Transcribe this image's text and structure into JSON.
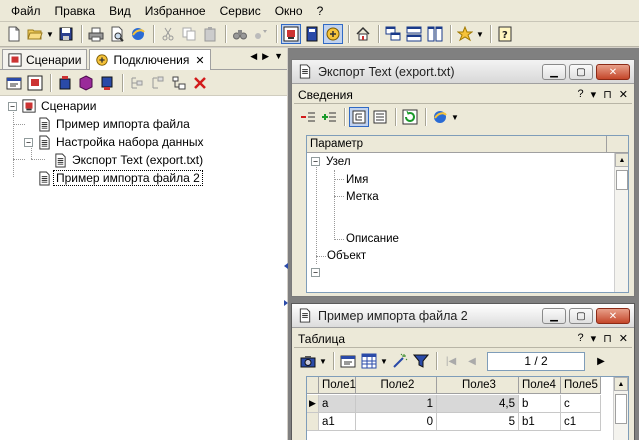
{
  "menu": [
    "Файл",
    "Правка",
    "Вид",
    "Избранное",
    "Сервис",
    "Окно",
    "?"
  ],
  "left_panel": {
    "tabs": [
      {
        "label": "Сценарии",
        "active": false
      },
      {
        "label": "Подключения",
        "active": true
      }
    ],
    "tab_close": "✕",
    "tree": [
      {
        "label": "Сценарии",
        "level": 0,
        "expander": "−"
      },
      {
        "label": "Пример импорта файла",
        "level": 1
      },
      {
        "label": "Настройка набора данных",
        "level": 1,
        "expander": "−"
      },
      {
        "label": "Экспорт Text (export.txt)",
        "level": 2
      },
      {
        "label": "Пример импорта файла 2",
        "level": 1,
        "selected": true
      }
    ]
  },
  "export_window": {
    "title": "Экспорт Text (export.txt)",
    "section": "Сведения",
    "section_ctrls": [
      "?",
      "▾",
      "⊓",
      "✕"
    ],
    "param_header": "Параметр",
    "params": [
      {
        "label": "Узел",
        "level": 0,
        "expander": "−"
      },
      {
        "label": "Имя",
        "level": 1
      },
      {
        "label": "Метка",
        "level": 1
      },
      {
        "label": "",
        "level": 1
      },
      {
        "label": "Описание",
        "level": 1
      },
      {
        "label": "Объект",
        "level": 0
      },
      {
        "label": "",
        "level": 0,
        "expander": "−"
      }
    ]
  },
  "import_window": {
    "title": "Пример импорта файла 2",
    "section": "Таблица",
    "section_ctrls": [
      "?",
      "▾",
      "⊓",
      "✕"
    ],
    "page_indicator": "1 / 2",
    "columns": [
      "Поле1",
      "Поле2",
      "Поле3",
      "Поле4",
      "Поле5"
    ],
    "rows": [
      [
        "a",
        "1",
        "4,5",
        "b",
        "c"
      ],
      [
        "a1",
        "0",
        "5",
        "b1",
        "c1"
      ]
    ],
    "current_row_marker": "▶"
  },
  "colors": {
    "background": "#d4d0c8",
    "mdi_background": "#808080",
    "selection": "#c1d2ee",
    "close_button": "#c4462a"
  }
}
